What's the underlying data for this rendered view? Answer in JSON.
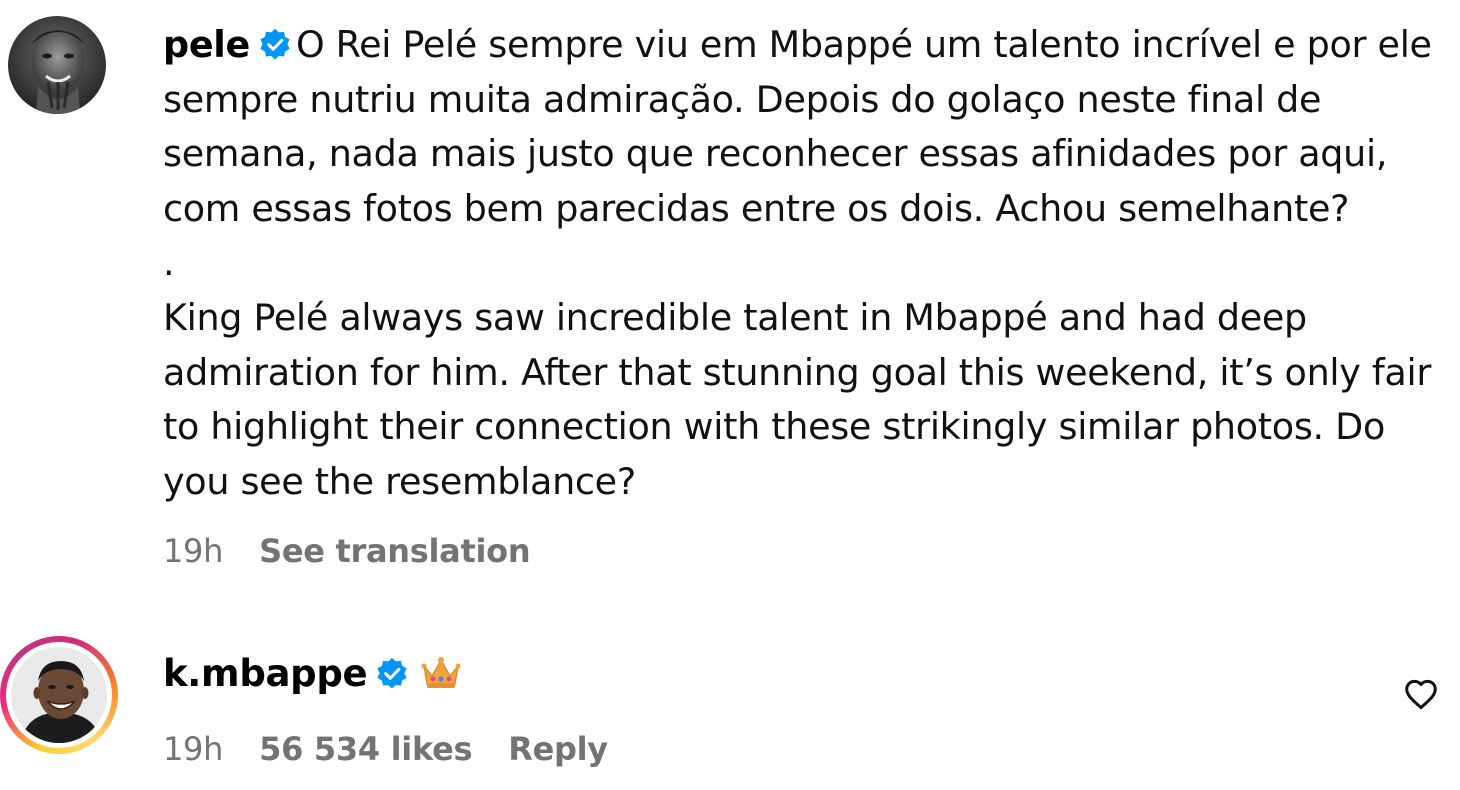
{
  "comments": [
    {
      "username": "pele",
      "verified": true,
      "text_pt": "O Rei Pelé sempre viu em Mbappé um talento incrível e por ele sempre nutriu muita admiração. Depois do golaço neste final de semana, nada mais justo que reconhecer essas afinidades por aqui, com essas fotos bem parecidas entre os dois. Achou semelhante?",
      "separator": ".",
      "text_en": "King Pelé always saw incredible talent in Mbappé and had deep admiration for him. After that stunning goal this weekend, it’s only fair to highlight their connection with these strikingly similar photos. Do you see the resemblance?",
      "time": "19h",
      "see_translation": "See translation",
      "avatar_icon": "pele-avatar-photo"
    },
    {
      "username": "k.mbappe",
      "verified": true,
      "emoji": "crown-emoji",
      "time": "19h",
      "likes": "56 534 likes",
      "reply": "Reply",
      "like_icon": "heart-outline-icon",
      "avatar_icon": "mbappe-avatar-photo",
      "story_ring": true
    }
  ],
  "colors": {
    "verified_blue": "#0095f6",
    "meta_gray": "#737373",
    "text": "#111111"
  }
}
